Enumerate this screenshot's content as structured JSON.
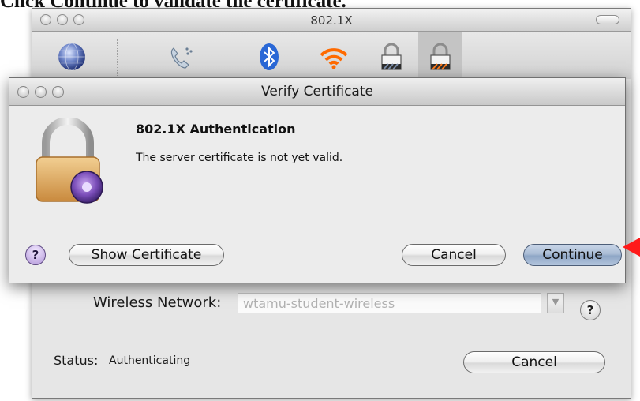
{
  "caption": "Click Continue to validate the certificate.",
  "bg_window": {
    "title": "802.1X",
    "toolbar_icons": [
      "network-globe-icon",
      "modem-phone-icon",
      "bluetooth-icon",
      "wifi-icon",
      "lock-ethernet-icon",
      "lock-airport-icon"
    ],
    "wireless_label": "Wireless Network:",
    "wireless_value": "wtamu-student-wireless",
    "help_label": "?",
    "status_label": "Status:",
    "status_value": "Authenticating",
    "cancel_label": "Cancel"
  },
  "dialog": {
    "title": "Verify Certificate",
    "heading": "802.1X Authentication",
    "message": "The server certificate is not yet valid.",
    "help_label": "?",
    "show_certificate_label": "Show Certificate",
    "cancel_label": "Cancel",
    "continue_label": "Continue"
  },
  "colors": {
    "pointer": "#ff1a1a",
    "continue_button": "#a9bcd5",
    "help_button": "#b196d8"
  }
}
